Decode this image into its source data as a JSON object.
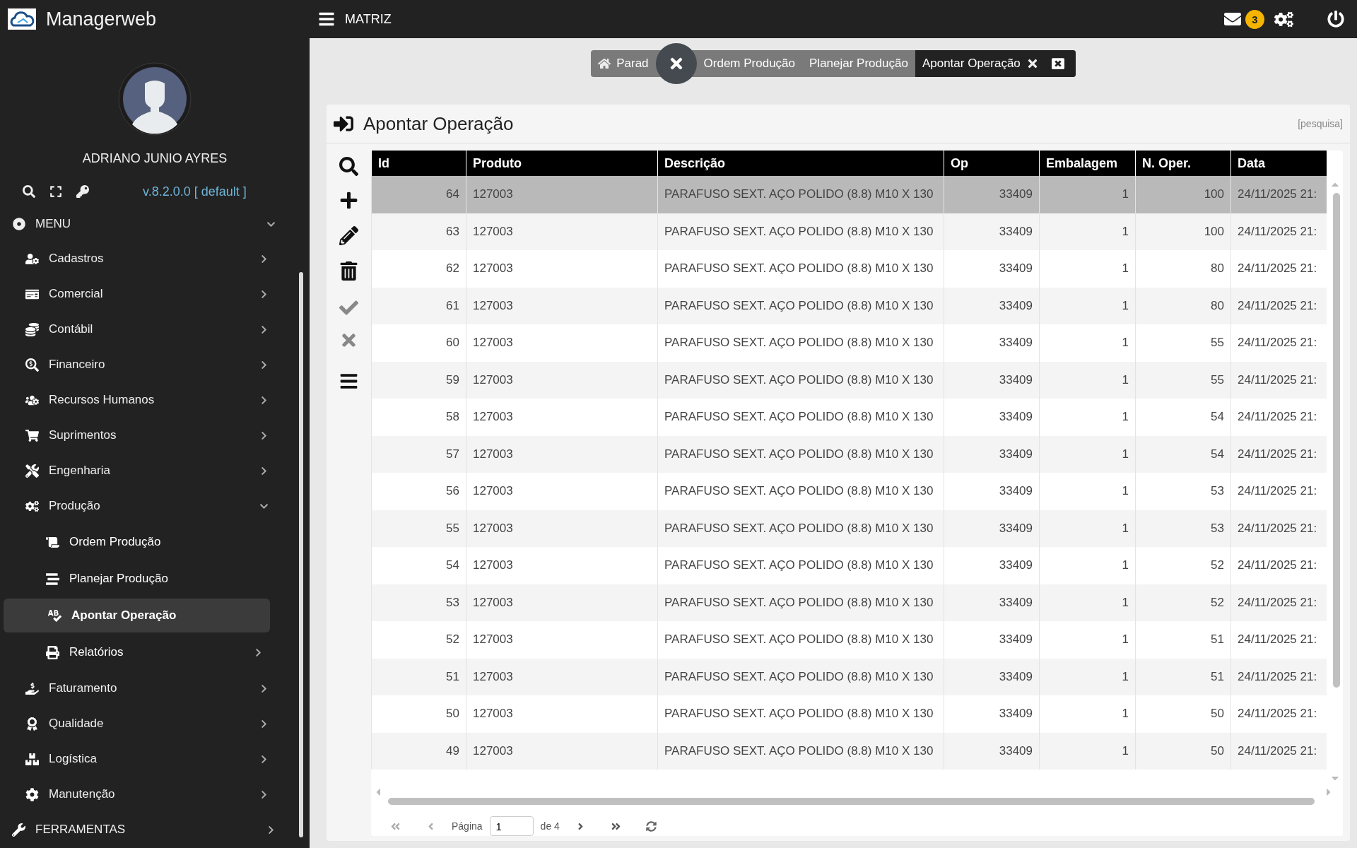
{
  "app": {
    "name": "Managerweb"
  },
  "topbar": {
    "company": "MATRIZ",
    "unread_count": "3"
  },
  "user": {
    "name": "ADRIANO JUNIO AYRES",
    "version": "v.8.2.0.0 [ default ]"
  },
  "sidebar": {
    "menu_label": "MENU",
    "menu_expanded": true,
    "items": [
      {
        "label": "Cadastros",
        "expanded": false
      },
      {
        "label": "Comercial",
        "expanded": false
      },
      {
        "label": "Contábil",
        "expanded": false
      },
      {
        "label": "Financeiro",
        "expanded": false
      },
      {
        "label": "Recursos Humanos",
        "expanded": false
      },
      {
        "label": "Suprimentos",
        "expanded": false
      },
      {
        "label": "Engenharia",
        "expanded": false
      },
      {
        "label": "Produção",
        "expanded": true,
        "children": [
          {
            "label": "Ordem Produção",
            "selected": false,
            "kind": "link"
          },
          {
            "label": "Planejar Produção",
            "selected": false,
            "kind": "link"
          },
          {
            "label": "Apontar Operação",
            "selected": true,
            "kind": "link"
          },
          {
            "label": "Relatórios",
            "selected": false,
            "kind": "folder"
          }
        ]
      },
      {
        "label": "Faturamento",
        "expanded": false
      },
      {
        "label": "Qualidade",
        "expanded": false
      },
      {
        "label": "Logística",
        "expanded": false
      },
      {
        "label": "Manutenção",
        "expanded": false
      }
    ],
    "tools_label": "FERRAMENTAS"
  },
  "breadcrumbs": [
    {
      "label": "Parad",
      "selected": false
    },
    {
      "label": "Ordem Produção",
      "selected": false
    },
    {
      "label": "Planejar Produção",
      "selected": false
    },
    {
      "label": "Apontar Operação",
      "selected": true
    }
  ],
  "panel": {
    "title": "Apontar Operação",
    "search_link": "[pesquisa]"
  },
  "table": {
    "columns": [
      "Id",
      "Produto",
      "Descrição",
      "Op",
      "Embalagem",
      "N. Oper.",
      "Data"
    ],
    "rows": [
      {
        "selected": true,
        "cells": [
          "64",
          "127003",
          "PARAFUSO SEXT. AÇO POLIDO (8.8) M10 X 130",
          "33409",
          "1",
          "100",
          "24/11/2025 21:"
        ]
      },
      {
        "selected": false,
        "cells": [
          "63",
          "127003",
          "PARAFUSO SEXT. AÇO POLIDO (8.8) M10 X 130",
          "33409",
          "1",
          "100",
          "24/11/2025 21:"
        ]
      },
      {
        "selected": false,
        "cells": [
          "62",
          "127003",
          "PARAFUSO SEXT. AÇO POLIDO (8.8) M10 X 130",
          "33409",
          "1",
          "80",
          "24/11/2025 21:"
        ]
      },
      {
        "selected": false,
        "cells": [
          "61",
          "127003",
          "PARAFUSO SEXT. AÇO POLIDO (8.8) M10 X 130",
          "33409",
          "1",
          "80",
          "24/11/2025 21:"
        ]
      },
      {
        "selected": false,
        "cells": [
          "60",
          "127003",
          "PARAFUSO SEXT. AÇO POLIDO (8.8) M10 X 130",
          "33409",
          "1",
          "55",
          "24/11/2025 21:"
        ]
      },
      {
        "selected": false,
        "cells": [
          "59",
          "127003",
          "PARAFUSO SEXT. AÇO POLIDO (8.8) M10 X 130",
          "33409",
          "1",
          "55",
          "24/11/2025 21:"
        ]
      },
      {
        "selected": false,
        "cells": [
          "58",
          "127003",
          "PARAFUSO SEXT. AÇO POLIDO (8.8) M10 X 130",
          "33409",
          "1",
          "54",
          "24/11/2025 21:"
        ]
      },
      {
        "selected": false,
        "cells": [
          "57",
          "127003",
          "PARAFUSO SEXT. AÇO POLIDO (8.8) M10 X 130",
          "33409",
          "1",
          "54",
          "24/11/2025 21:"
        ]
      },
      {
        "selected": false,
        "cells": [
          "56",
          "127003",
          "PARAFUSO SEXT. AÇO POLIDO (8.8) M10 X 130",
          "33409",
          "1",
          "53",
          "24/11/2025 21:"
        ]
      },
      {
        "selected": false,
        "cells": [
          "55",
          "127003",
          "PARAFUSO SEXT. AÇO POLIDO (8.8) M10 X 130",
          "33409",
          "1",
          "53",
          "24/11/2025 21:"
        ]
      },
      {
        "selected": false,
        "cells": [
          "54",
          "127003",
          "PARAFUSO SEXT. AÇO POLIDO (8.8) M10 X 130",
          "33409",
          "1",
          "52",
          "24/11/2025 21:"
        ]
      },
      {
        "selected": false,
        "cells": [
          "53",
          "127003",
          "PARAFUSO SEXT. AÇO POLIDO (8.8) M10 X 130",
          "33409",
          "1",
          "52",
          "24/11/2025 21:"
        ]
      },
      {
        "selected": false,
        "cells": [
          "52",
          "127003",
          "PARAFUSO SEXT. AÇO POLIDO (8.8) M10 X 130",
          "33409",
          "1",
          "51",
          "24/11/2025 21:"
        ]
      },
      {
        "selected": false,
        "cells": [
          "51",
          "127003",
          "PARAFUSO SEXT. AÇO POLIDO (8.8) M10 X 130",
          "33409",
          "1",
          "51",
          "24/11/2025 21:"
        ]
      },
      {
        "selected": false,
        "cells": [
          "50",
          "127003",
          "PARAFUSO SEXT. AÇO POLIDO (8.8) M10 X 130",
          "33409",
          "1",
          "50",
          "24/11/2025 21:"
        ]
      },
      {
        "selected": false,
        "cells": [
          "49",
          "127003",
          "PARAFUSO SEXT. AÇO POLIDO (8.8) M10 X 130",
          "33409",
          "1",
          "50",
          "24/11/2025 21:"
        ]
      }
    ]
  },
  "pagination": {
    "page_label": "Página",
    "page": "1",
    "of_label": "de 4"
  }
}
